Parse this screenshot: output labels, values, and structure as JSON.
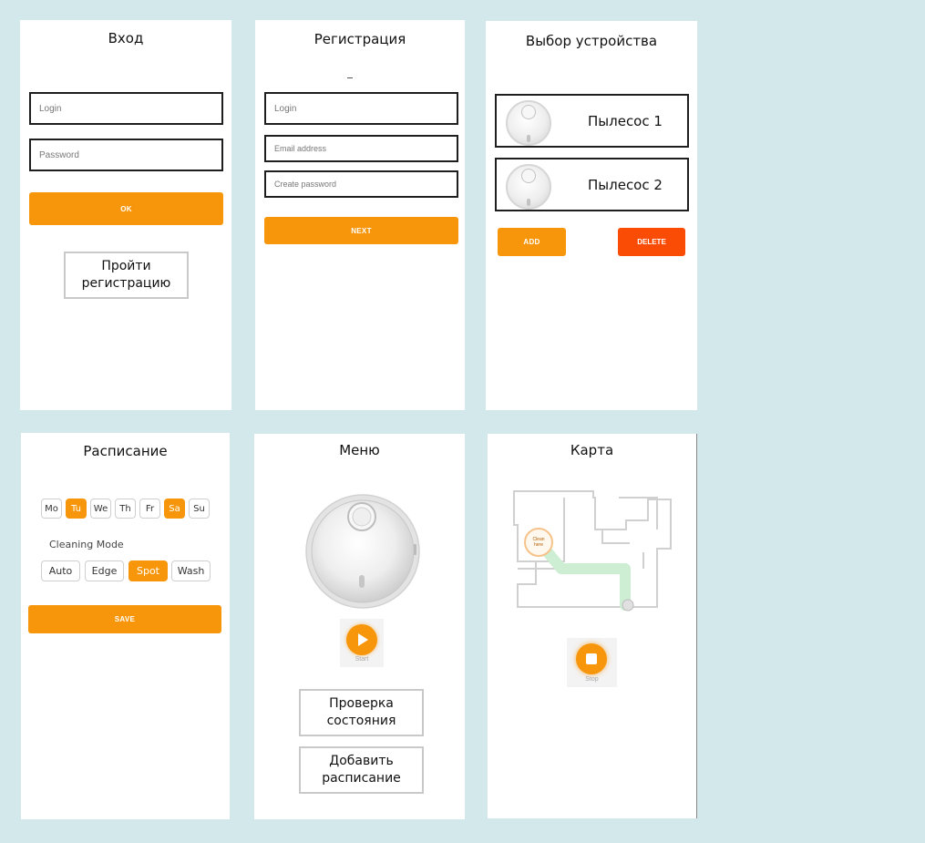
{
  "login": {
    "title": "Вход",
    "login_placeholder": "Login",
    "password_placeholder": "Password",
    "ok_label": "OK",
    "register_line1": "Пройти",
    "register_line2": "регистрацию"
  },
  "registration": {
    "title": "Регистрация",
    "login_placeholder": "Login",
    "email_placeholder": "Email address",
    "password_placeholder": "Create password",
    "next_label": "NEXT"
  },
  "device_select": {
    "title": "Выбор устройства",
    "devices": [
      {
        "name": "Пылесос 1"
      },
      {
        "name": "Пылесос 2"
      }
    ],
    "add_label": "ADD",
    "delete_label": "DELETE"
  },
  "schedule": {
    "title": "Расписание",
    "days": [
      {
        "label": "Mo",
        "selected": false
      },
      {
        "label": "Tu",
        "selected": true
      },
      {
        "label": "We",
        "selected": false
      },
      {
        "label": "Th",
        "selected": false
      },
      {
        "label": "Fr",
        "selected": false
      },
      {
        "label": "Sa",
        "selected": true
      },
      {
        "label": "Su",
        "selected": false
      }
    ],
    "cleaning_mode_label": "Cleaning Mode",
    "modes": [
      {
        "label": "Auto",
        "selected": false
      },
      {
        "label": "Edge",
        "selected": false
      },
      {
        "label": "Spot",
        "selected": true
      },
      {
        "label": "Wash",
        "selected": false
      }
    ],
    "save_label": "SAVE"
  },
  "menu": {
    "title": "Меню",
    "start_label": "Start",
    "status_line1": "Проверка",
    "status_line2": "состояния",
    "schedule_line1": "Добавить",
    "schedule_line2": "расписание"
  },
  "map": {
    "title": "Карта",
    "clean_here_line1": "Clean",
    "clean_here_line2": "here",
    "stop_label": "Stop"
  },
  "colors": {
    "background": "#d3e8ea",
    "accent_orange": "#f7960a",
    "delete_red": "#fb4c06",
    "path_green": "#cdeed3"
  }
}
